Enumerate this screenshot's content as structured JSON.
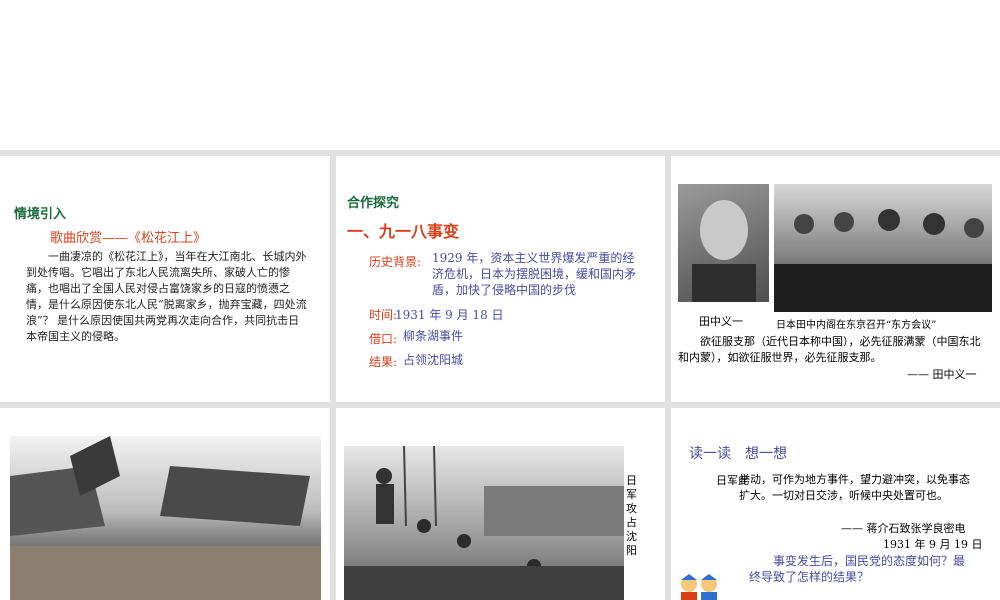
{
  "slide1": {
    "heading": "情境引入",
    "subheading": "歌曲欣赏——《松花江上》",
    "paragraph": "一曲凄凉的《松花江上》，当年在大江南北、长城内外到处传唱。它唱出了东北人民流离失所、家破人亡的惨痛，也唱出了全国人民对侵占富饶家乡的日寇的愤懑之情，是什么原因使东北人民“脱离家乡，抛弃宝藏，四处流浪”？ 是什么原因使国共两党再次走向合作，共同抗击日本帝国主义的侵略。"
  },
  "slide2": {
    "heading": "合作探究",
    "title": "一、九一八事变",
    "rows": [
      {
        "label": "历史背景:",
        "value": "1929 年，资本主义世界爆发严重的经济危机，日本为摆脱困境，缓和国内矛盾，加快了侵略中国的步伐"
      },
      {
        "label": "时间:",
        "value": "1931 年 9 月 18 日"
      },
      {
        "label": "借口:",
        "value": "柳条湖事件"
      },
      {
        "label": "结果:",
        "value": "占领沈阳城"
      }
    ]
  },
  "slide3": {
    "portrait_caption": "田中义一",
    "meeting_caption": "日本田中内阁在东京召开“东方会议”",
    "quote": "欲征服支那（近代日本称中国），必先征服满蒙（中国东北和内蒙），如欲征服世界，必先征服支那。",
    "attribution": "—— 田中义一"
  },
  "slide5": {
    "vertical_caption": "日军攻占沈阳"
  },
  "slide6": {
    "heading": "读一读　想一想",
    "telegram_lead": "日军此",
    "telegram": "举动，可作为地方事件，望力避冲突，以免事态扩大。一切对日交涉，听候中央处置可也。",
    "attribution": "—— 蒋介石致张学良密电",
    "date": "1931 年 9 月 19 日",
    "question": "事变发生后，国民党的态度如何？最终导致了怎样的结果？"
  },
  "colors": {
    "heading_green": "#1a6b3c",
    "accent_red": "#d9401a",
    "text_blue": "#4a4a9e",
    "divider_gray": "#e1e1e1"
  }
}
